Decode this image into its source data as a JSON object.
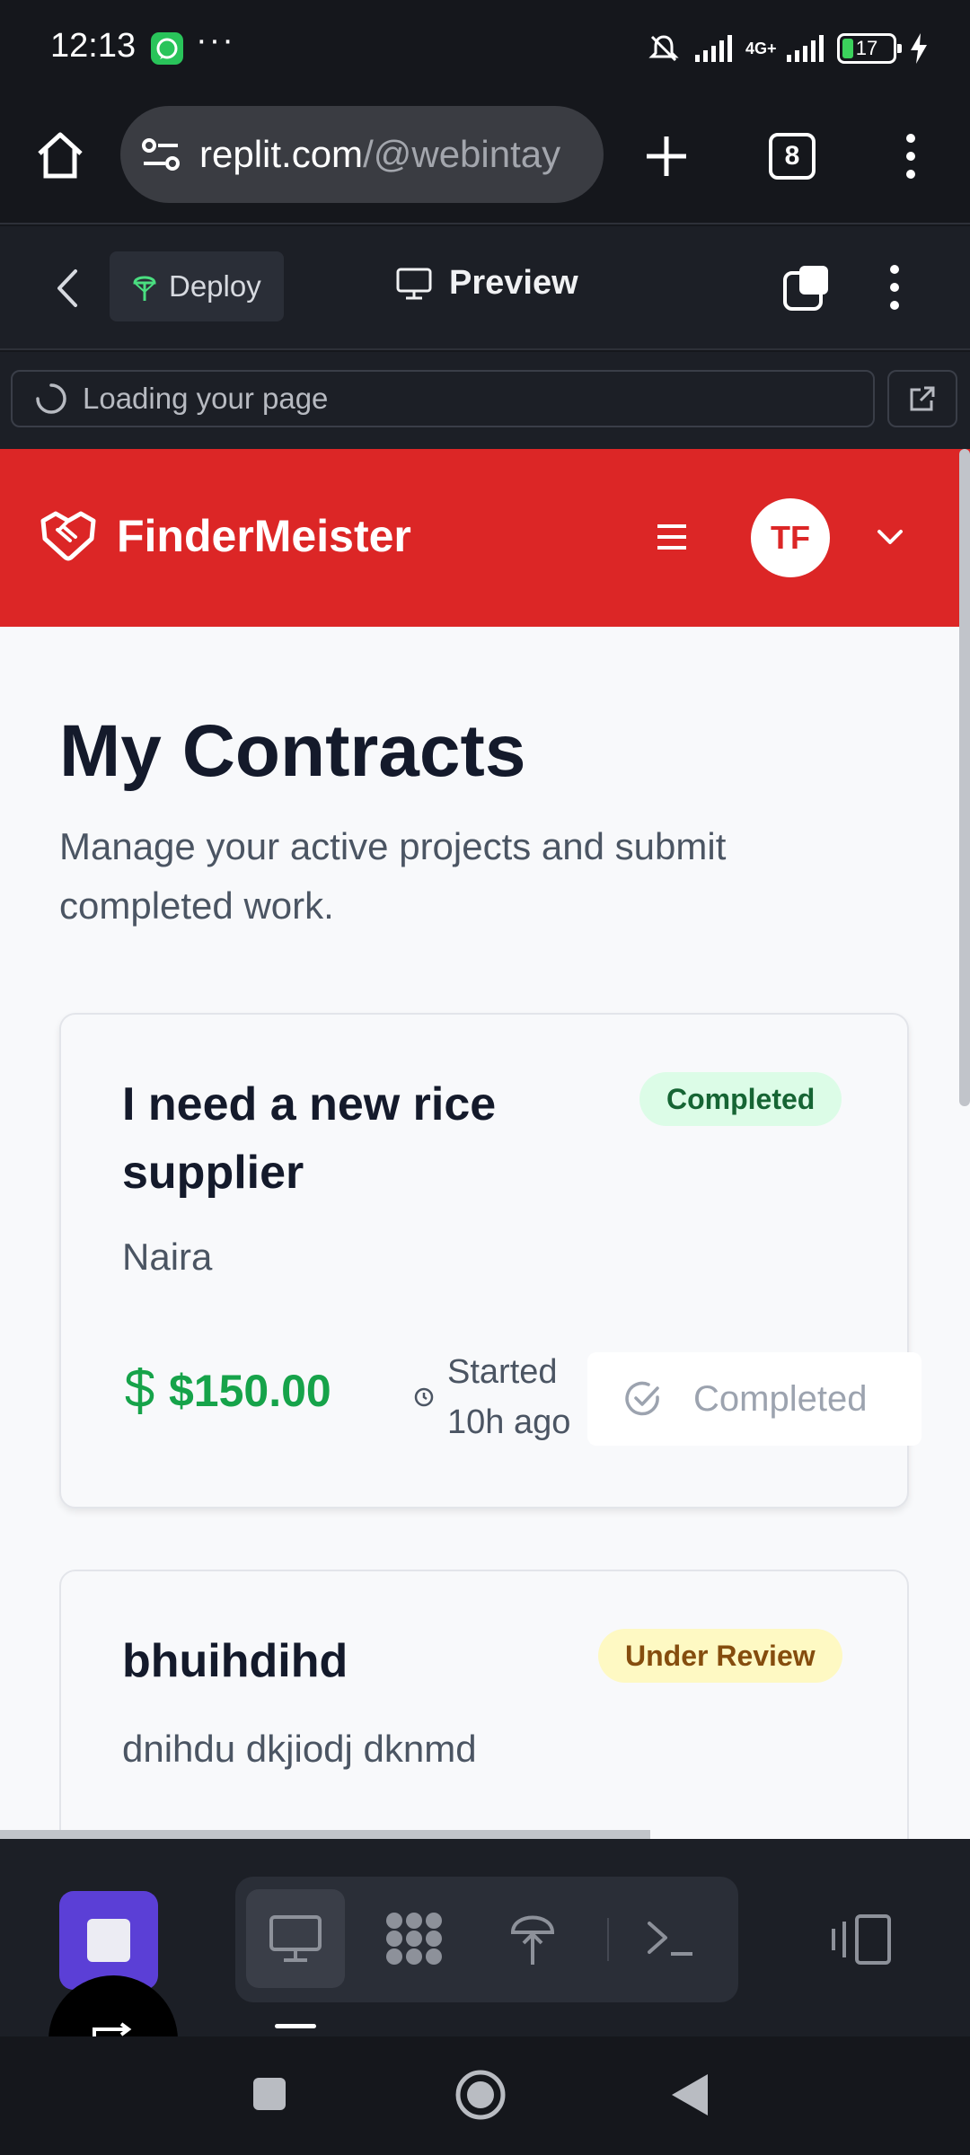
{
  "status_bar": {
    "time": "12:13",
    "more": "···",
    "network": "4G+",
    "battery": "17"
  },
  "browser": {
    "url_host": "replit.com",
    "url_path": "/@webintay",
    "tab_count": "8"
  },
  "replit_toolbar": {
    "deploy_label": "Deploy",
    "preview_label": "Preview"
  },
  "preview_url": {
    "loading_text": "Loading your page"
  },
  "app": {
    "brand": "FinderMeister",
    "avatar_initials": "TF",
    "page_title": "My Contracts",
    "page_subtitle": "Manage your active projects and submit completed work.",
    "contracts": [
      {
        "title": "I need a new rice supplier",
        "description": "Naira",
        "status": "Completed",
        "amount": "$150.00",
        "started": "Started 10h ago",
        "action_label": "Completed"
      },
      {
        "title": "bhuihdihd",
        "description": "dnihdu dkjiodj dknmd",
        "status": "Under Review"
      }
    ]
  },
  "colors": {
    "brand_red": "#dc2626",
    "success_green": "#16a34a",
    "replit_purple": "#5b3fd6"
  }
}
